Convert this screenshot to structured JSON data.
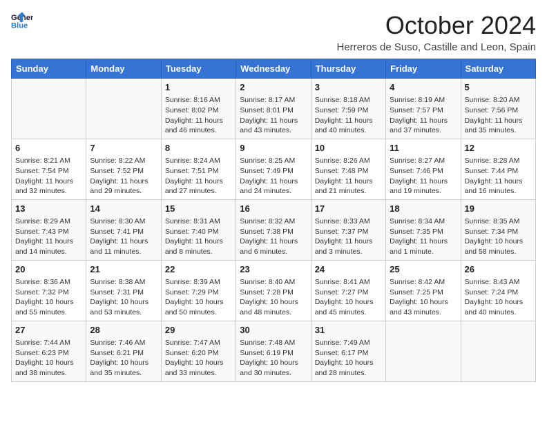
{
  "header": {
    "logo_line1": "General",
    "logo_line2": "Blue",
    "month_title": "October 2024",
    "location": "Herreros de Suso, Castille and Leon, Spain"
  },
  "weekdays": [
    "Sunday",
    "Monday",
    "Tuesday",
    "Wednesday",
    "Thursday",
    "Friday",
    "Saturday"
  ],
  "weeks": [
    [
      {
        "day": "",
        "info": ""
      },
      {
        "day": "",
        "info": ""
      },
      {
        "day": "1",
        "info": "Sunrise: 8:16 AM\nSunset: 8:02 PM\nDaylight: 11 hours and 46 minutes."
      },
      {
        "day": "2",
        "info": "Sunrise: 8:17 AM\nSunset: 8:01 PM\nDaylight: 11 hours and 43 minutes."
      },
      {
        "day": "3",
        "info": "Sunrise: 8:18 AM\nSunset: 7:59 PM\nDaylight: 11 hours and 40 minutes."
      },
      {
        "day": "4",
        "info": "Sunrise: 8:19 AM\nSunset: 7:57 PM\nDaylight: 11 hours and 37 minutes."
      },
      {
        "day": "5",
        "info": "Sunrise: 8:20 AM\nSunset: 7:56 PM\nDaylight: 11 hours and 35 minutes."
      }
    ],
    [
      {
        "day": "6",
        "info": "Sunrise: 8:21 AM\nSunset: 7:54 PM\nDaylight: 11 hours and 32 minutes."
      },
      {
        "day": "7",
        "info": "Sunrise: 8:22 AM\nSunset: 7:52 PM\nDaylight: 11 hours and 29 minutes."
      },
      {
        "day": "8",
        "info": "Sunrise: 8:24 AM\nSunset: 7:51 PM\nDaylight: 11 hours and 27 minutes."
      },
      {
        "day": "9",
        "info": "Sunrise: 8:25 AM\nSunset: 7:49 PM\nDaylight: 11 hours and 24 minutes."
      },
      {
        "day": "10",
        "info": "Sunrise: 8:26 AM\nSunset: 7:48 PM\nDaylight: 11 hours and 21 minutes."
      },
      {
        "day": "11",
        "info": "Sunrise: 8:27 AM\nSunset: 7:46 PM\nDaylight: 11 hours and 19 minutes."
      },
      {
        "day": "12",
        "info": "Sunrise: 8:28 AM\nSunset: 7:44 PM\nDaylight: 11 hours and 16 minutes."
      }
    ],
    [
      {
        "day": "13",
        "info": "Sunrise: 8:29 AM\nSunset: 7:43 PM\nDaylight: 11 hours and 14 minutes."
      },
      {
        "day": "14",
        "info": "Sunrise: 8:30 AM\nSunset: 7:41 PM\nDaylight: 11 hours and 11 minutes."
      },
      {
        "day": "15",
        "info": "Sunrise: 8:31 AM\nSunset: 7:40 PM\nDaylight: 11 hours and 8 minutes."
      },
      {
        "day": "16",
        "info": "Sunrise: 8:32 AM\nSunset: 7:38 PM\nDaylight: 11 hours and 6 minutes."
      },
      {
        "day": "17",
        "info": "Sunrise: 8:33 AM\nSunset: 7:37 PM\nDaylight: 11 hours and 3 minutes."
      },
      {
        "day": "18",
        "info": "Sunrise: 8:34 AM\nSunset: 7:35 PM\nDaylight: 11 hours and 1 minute."
      },
      {
        "day": "19",
        "info": "Sunrise: 8:35 AM\nSunset: 7:34 PM\nDaylight: 10 hours and 58 minutes."
      }
    ],
    [
      {
        "day": "20",
        "info": "Sunrise: 8:36 AM\nSunset: 7:32 PM\nDaylight: 10 hours and 55 minutes."
      },
      {
        "day": "21",
        "info": "Sunrise: 8:38 AM\nSunset: 7:31 PM\nDaylight: 10 hours and 53 minutes."
      },
      {
        "day": "22",
        "info": "Sunrise: 8:39 AM\nSunset: 7:29 PM\nDaylight: 10 hours and 50 minutes."
      },
      {
        "day": "23",
        "info": "Sunrise: 8:40 AM\nSunset: 7:28 PM\nDaylight: 10 hours and 48 minutes."
      },
      {
        "day": "24",
        "info": "Sunrise: 8:41 AM\nSunset: 7:27 PM\nDaylight: 10 hours and 45 minutes."
      },
      {
        "day": "25",
        "info": "Sunrise: 8:42 AM\nSunset: 7:25 PM\nDaylight: 10 hours and 43 minutes."
      },
      {
        "day": "26",
        "info": "Sunrise: 8:43 AM\nSunset: 7:24 PM\nDaylight: 10 hours and 40 minutes."
      }
    ],
    [
      {
        "day": "27",
        "info": "Sunrise: 7:44 AM\nSunset: 6:23 PM\nDaylight: 10 hours and 38 minutes."
      },
      {
        "day": "28",
        "info": "Sunrise: 7:46 AM\nSunset: 6:21 PM\nDaylight: 10 hours and 35 minutes."
      },
      {
        "day": "29",
        "info": "Sunrise: 7:47 AM\nSunset: 6:20 PM\nDaylight: 10 hours and 33 minutes."
      },
      {
        "day": "30",
        "info": "Sunrise: 7:48 AM\nSunset: 6:19 PM\nDaylight: 10 hours and 30 minutes."
      },
      {
        "day": "31",
        "info": "Sunrise: 7:49 AM\nSunset: 6:17 PM\nDaylight: 10 hours and 28 minutes."
      },
      {
        "day": "",
        "info": ""
      },
      {
        "day": "",
        "info": ""
      }
    ]
  ]
}
